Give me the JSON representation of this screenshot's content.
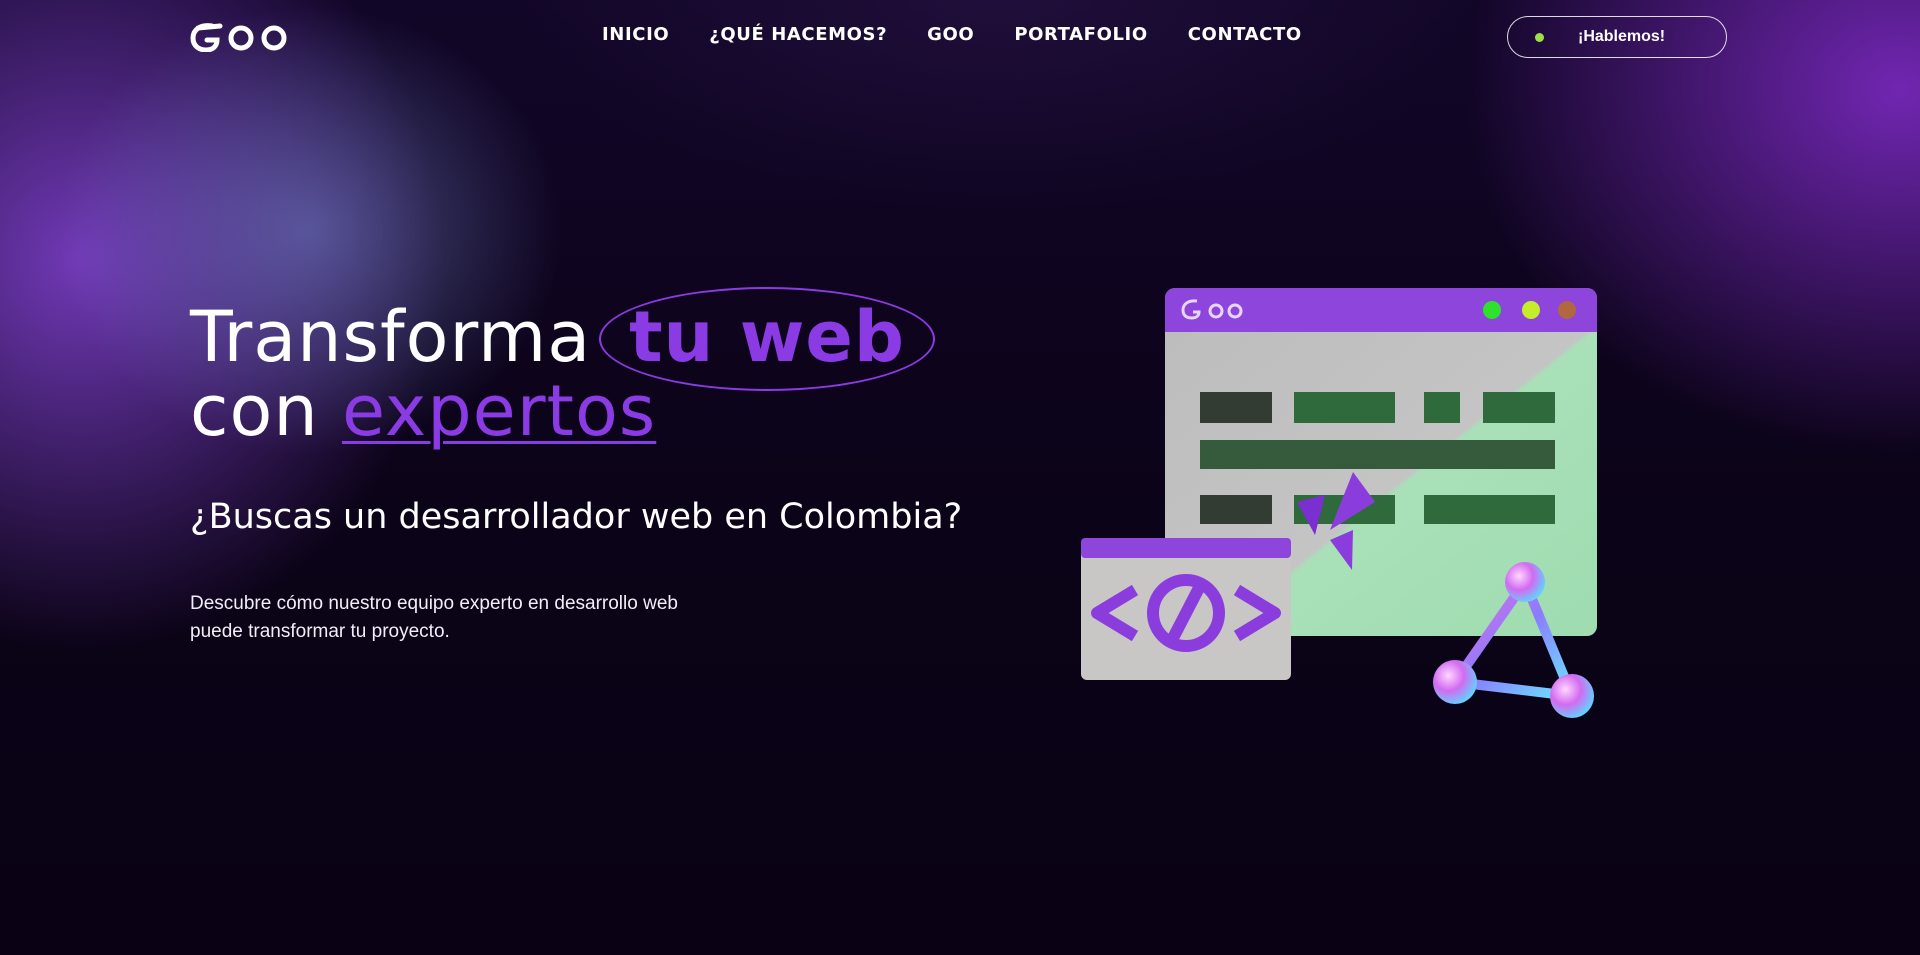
{
  "nav": {
    "logo_text": "Goo",
    "items": [
      {
        "label": "INICIO"
      },
      {
        "label": "¿QUÉ HACEMOS?"
      },
      {
        "label": "GOO"
      },
      {
        "label": "PORTAFOLIO"
      },
      {
        "label": "CONTACTO"
      }
    ],
    "cta_label": "¡Hablemos!"
  },
  "hero": {
    "title_part1": "Transforma",
    "title_highlight": "tu web",
    "title_part2": "con",
    "title_underlined": "expertos",
    "subtitle": "¿Buscas un desarrollador web en Colombia?",
    "description": "Descubre cómo nuestro equipo experto en desarrollo web puede transformar tu proyecto."
  },
  "colors": {
    "accent": "#8b3be3",
    "cta_dot": "#9be04a",
    "background": "#0c0418"
  },
  "illustration": {
    "icon": "browser-window-code-illustration"
  }
}
